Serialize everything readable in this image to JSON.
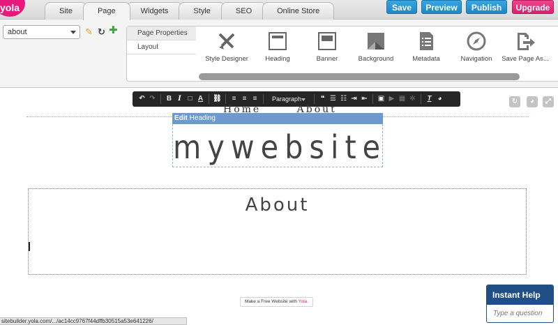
{
  "topbar": {
    "logo_text": "yola",
    "tabs": [
      "Site",
      "Page",
      "Widgets",
      "Style",
      "SEO",
      "Online Store"
    ],
    "active_tab": "Page",
    "buttons": {
      "save": "Save",
      "preview": "Preview",
      "publish": "Publish",
      "upgrade": "Upgrade"
    },
    "colors": {
      "blue": "#2596d6",
      "pink": "#e8267a"
    }
  },
  "page_panel": {
    "page_select": "about",
    "icons": [
      "pencil-icon",
      "refresh-icon",
      "add-icon"
    ],
    "subnav": [
      "Page Properties",
      "Layout"
    ],
    "tools": [
      {
        "label": "Style Designer",
        "icon": "brush-pencil-icon"
      },
      {
        "label": "Heading",
        "icon": "heading-icon"
      },
      {
        "label": "Banner",
        "icon": "banner-icon"
      },
      {
        "label": "Background",
        "icon": "background-icon"
      },
      {
        "label": "Metadata",
        "icon": "metadata-icon"
      },
      {
        "label": "Navigation",
        "icon": "compass-icon"
      },
      {
        "label": "Save Page As...",
        "icon": "export-icon"
      }
    ]
  },
  "editor_toolbar": {
    "format": "Paragraph"
  },
  "canvas": {
    "nav_items": [
      "Home",
      "About"
    ],
    "edit_label_bold": "Edit",
    "edit_label_rest": "Heading",
    "site_title": "mywebsite",
    "content_heading": "About"
  },
  "footer": {
    "badge_prefix": "Make a Free Website with",
    "badge_brand": "Yola."
  },
  "status_bar": {
    "url": "sitebuilder.yola.com/.../ac14cc9767f44dffb30515a53e641226/"
  },
  "help": {
    "title": "Instant Help",
    "placeholder": "Type a question"
  }
}
